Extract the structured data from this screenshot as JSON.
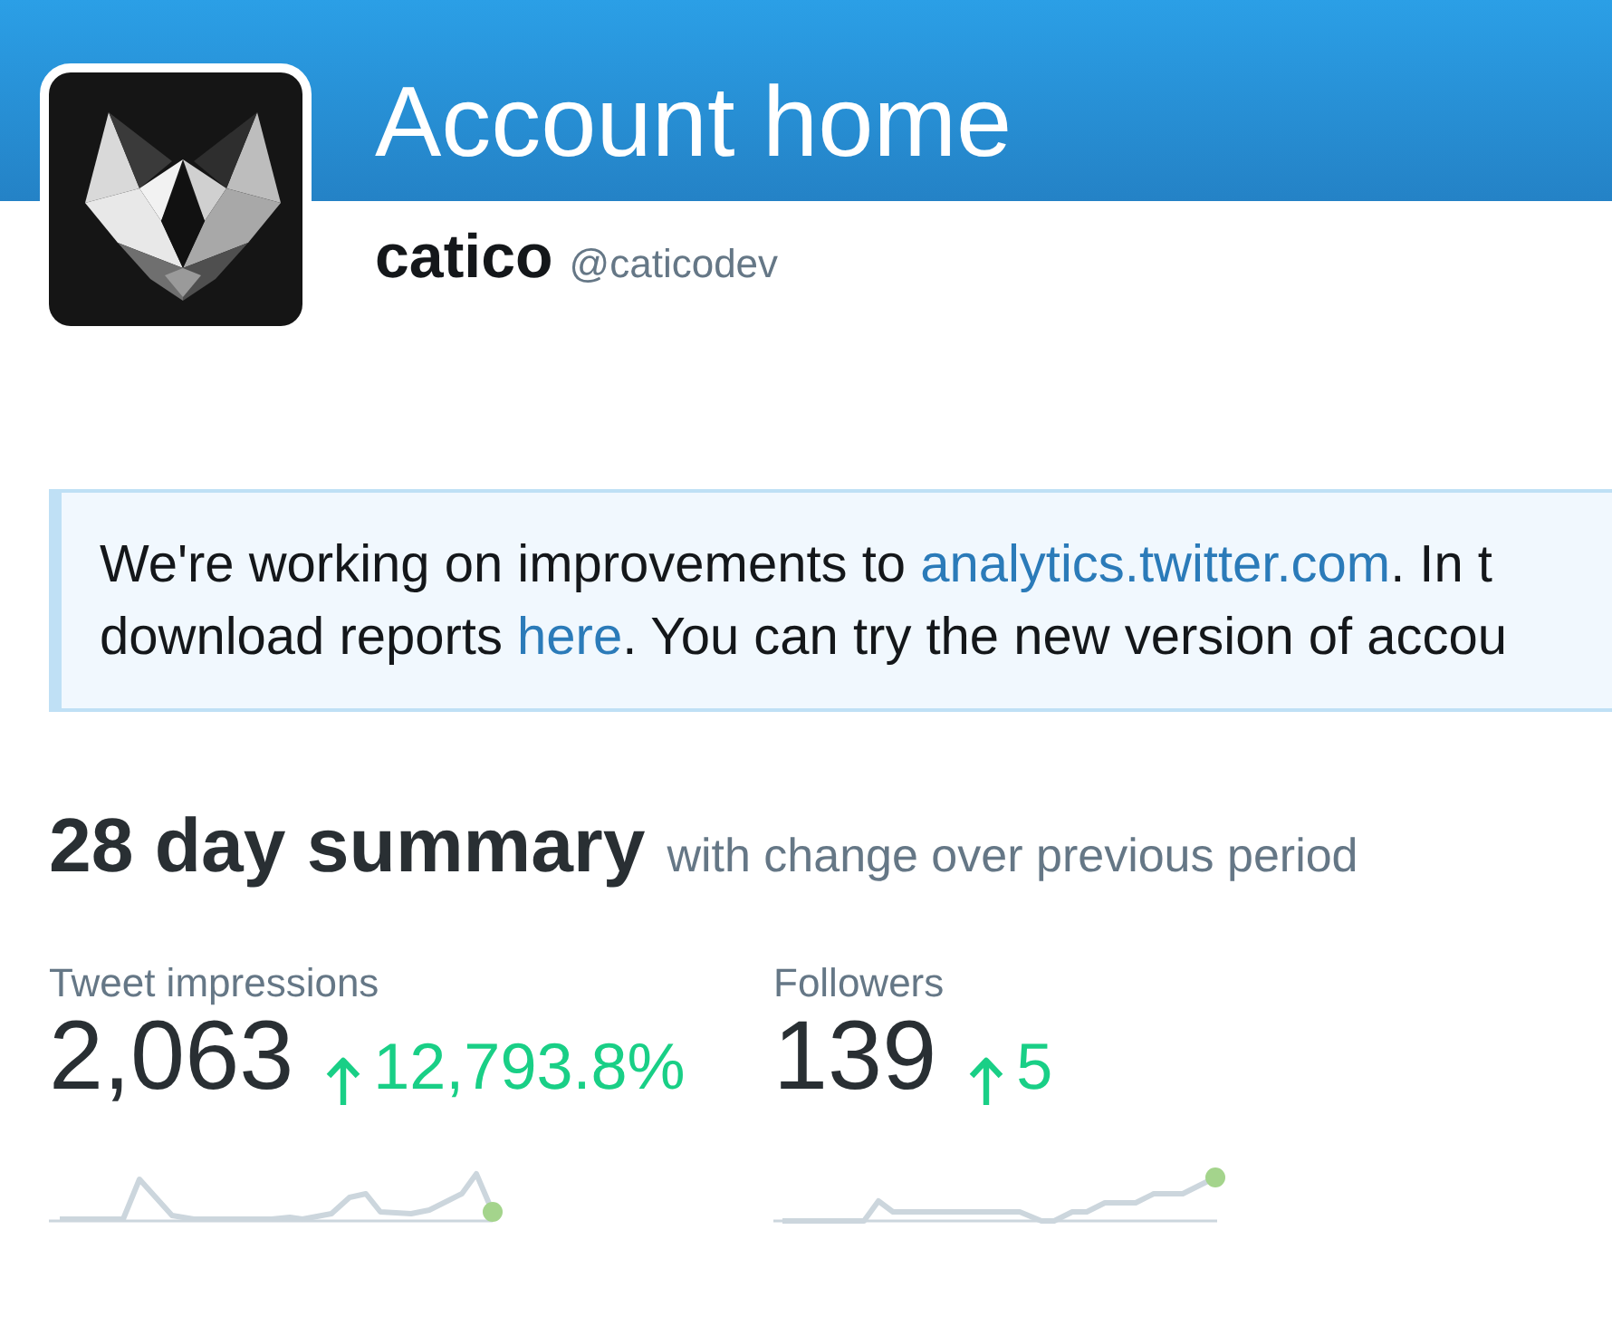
{
  "header": {
    "title": "Account home"
  },
  "profile": {
    "name": "catico",
    "handle": "@caticodev"
  },
  "notice": {
    "lines": [
      {
        "segments": [
          {
            "kind": "text",
            "text": "We're working on improvements to "
          },
          {
            "kind": "link",
            "text": "analytics.twitter.com"
          },
          {
            "kind": "text",
            "text": ". In t"
          }
        ]
      },
      {
        "segments": [
          {
            "kind": "text",
            "text": "download reports "
          },
          {
            "kind": "link",
            "text": "here"
          },
          {
            "kind": "text",
            "text": ". You can try the new version of accou"
          }
        ]
      }
    ]
  },
  "summary": {
    "title": "28 day summary",
    "subtitle": "with change over previous period"
  },
  "metrics": [
    {
      "label": "Tweet impressions",
      "value": "2,063",
      "change": "12,793.8%"
    },
    {
      "label": "Followers",
      "value": "139",
      "change": "5"
    }
  ]
}
